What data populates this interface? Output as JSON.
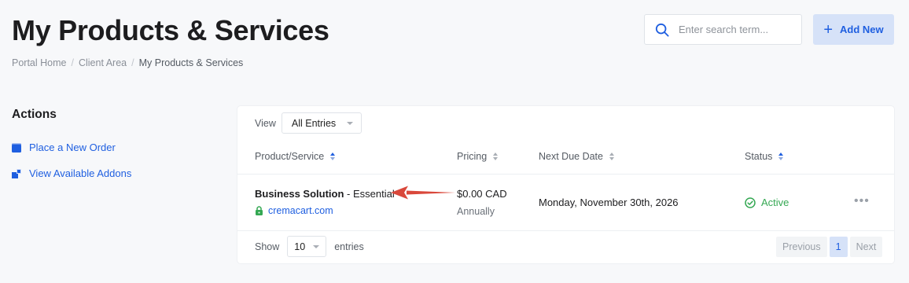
{
  "header": {
    "title": "My Products & Services",
    "breadcrumb": [
      "Portal Home",
      "Client Area",
      "My Products & Services"
    ]
  },
  "search": {
    "placeholder": "Enter search term..."
  },
  "add_new": {
    "label": "Add New"
  },
  "actions": {
    "title": "Actions",
    "items": [
      {
        "label": "Place a New Order",
        "icon": "cart-icon"
      },
      {
        "label": "View Available Addons",
        "icon": "cubes-icon"
      }
    ]
  },
  "table": {
    "view_label": "View",
    "view_selected": "All Entries",
    "columns": [
      "Product/Service",
      "Pricing",
      "Next Due Date",
      "Status"
    ],
    "rows": [
      {
        "product": "Business Solution",
        "plan": " - Essential",
        "domain": "cremacart.com",
        "price": "$0.00 CAD",
        "cycle": "Annually",
        "next_due": "Monday, November 30th, 2026",
        "status": "Active"
      }
    ],
    "show_label": "Show",
    "page_size": "10",
    "entries_label": "entries",
    "pagination": {
      "previous": "Previous",
      "current": "1",
      "next": "Next"
    }
  },
  "colors": {
    "accent": "#1f5fe0",
    "active_status": "#35a853",
    "annotation_arrow": "#d9483b"
  }
}
